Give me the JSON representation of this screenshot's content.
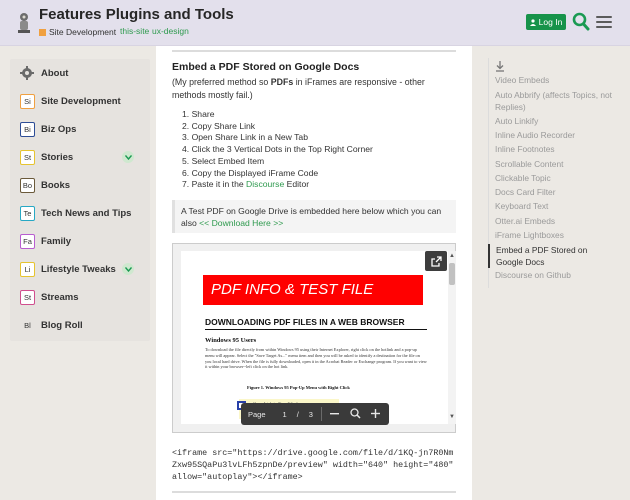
{
  "header": {
    "site_title": "Features Plugins and Tools",
    "category": "Site Development",
    "category_color": "#f0a040",
    "tags": [
      "this-site",
      "ux-design"
    ],
    "login_label": "Log In",
    "accent_color": "#17934a"
  },
  "sidebar": {
    "items": [
      {
        "badge": "",
        "label": "About",
        "icon": "gear-icon"
      },
      {
        "badge": "Si",
        "label": "Site Development",
        "color": "#f0a040"
      },
      {
        "badge": "Bi",
        "label": "Biz Ops",
        "color": "#2d4d96"
      },
      {
        "badge": "St",
        "label": "Stories",
        "color": "#e6c430"
      },
      {
        "badge": "Bo",
        "label": "Books",
        "color": "#6b5a3a"
      },
      {
        "badge": "Te",
        "label": "Tech News and Tips",
        "color": "#27a8c4"
      },
      {
        "badge": "Fa",
        "label": "Family",
        "color": "#b85dd0"
      },
      {
        "badge": "Li",
        "label": "Lifestyle Tweaks",
        "color": "#e6c430"
      },
      {
        "badge": "St",
        "label": "Streams",
        "color": "#d04f8e"
      },
      {
        "badge": "Bl",
        "label": "Blog Roll",
        "color": ""
      }
    ]
  },
  "post": {
    "title": "Embed a PDF Stored on Google Docs",
    "intro_pre": "(My preferred method so ",
    "intro_bold": "PDFs",
    "intro_post": " in iFrames are responsive - other methods mostly fail.)",
    "steps": [
      "Share",
      "Copy Share Link",
      "Open Share Link in a New Tab",
      "Click the 3 Vertical Dots in the Top Right Corner",
      "Select Embed Item",
      "Copy the Displayed iFrame Code"
    ],
    "step7_pre": "Paste it in the ",
    "step7_link": "Discourse",
    "step7_post": " Editor",
    "quote_text": "A Test PDF on Google Drive is embedded here below which you can also ",
    "quote_link": "<< Download Here >>",
    "code": "<iframe src=\"https://drive.google.com/file/d/1KQ-jn7R0NmZxw95SQaPu3lvLFh5zpnDe/preview\" width=\"640\" height=\"480\" allow=\"autoplay\"></iframe>"
  },
  "pdf": {
    "banner": "PDF INFO & TEST FILE",
    "heading": "DOWNLOADING PDF FILES IN A WEB BROWSER",
    "subheading": "Windows 95 Users",
    "body": "To download the file directly from within Windows 95 using their Internet Explorer, right click on the hotlink and a pop-up menu will appear. Select the \"Save Target As...\" menu item and then you will be asked to identify a destination for the file on you local hard drive. When the file is fully downloaded, open it in the Acrobat Reader or Exchange program. If you want to view it within your browser--left click on the hot link.",
    "figure": "Figure 1. Windows 95 Pop-Up Menu with Right Click",
    "menu_text": "Open Link in New Window",
    "toolbar": {
      "label": "Page",
      "page": "1",
      "sep": "/",
      "total": "3"
    }
  },
  "toc": {
    "items": [
      {
        "label": "Video Embeds",
        "active": false
      },
      {
        "label": "Auto Abbrify (affects Topics, not Replies)",
        "active": false
      },
      {
        "label": "Auto Linkify",
        "active": false
      },
      {
        "label": "Inline Audio Recorder",
        "active": false
      },
      {
        "label": "Inline Footnotes",
        "active": false
      },
      {
        "label": "Scrollable Content",
        "active": false
      },
      {
        "label": "Clickable Topic",
        "active": false
      },
      {
        "label": "Docs Card Filter",
        "active": false
      },
      {
        "label": "Keyboard Text",
        "active": false
      },
      {
        "label": "Otter.ai Embeds",
        "active": false
      },
      {
        "label": "iFrame Lightboxes",
        "active": false
      },
      {
        "label": "Embed a PDF Stored on Google Docs",
        "active": true
      },
      {
        "label": "Discourse on Github",
        "active": false
      }
    ]
  }
}
